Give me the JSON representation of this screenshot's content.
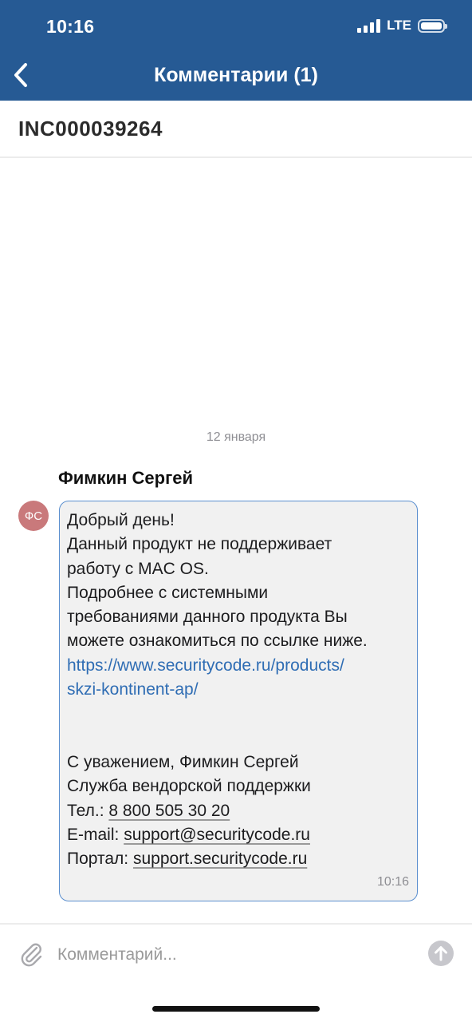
{
  "status_bar": {
    "time": "10:16",
    "network": "LTE"
  },
  "header": {
    "title": "Комментарии (1)"
  },
  "incident": {
    "number": "INC000039264"
  },
  "thread": {
    "date_separator": "12 января",
    "messages": [
      {
        "author": "Фимкин Сергей",
        "avatar_initials": "ФС",
        "avatar_color": "#c9797b",
        "time": "10:16",
        "lines": [
          "Добрый день!",
          "Данный продукт не поддерживает",
          "работу с MAC OS.",
          "Подробнее с системными",
          "требованиями данного продукта Вы",
          "можете ознакомиться по ссылке ниже."
        ],
        "link_lines": [
          "https://www.securitycode.ru/products/",
          "skzi-kontinent-ap/"
        ],
        "signature": {
          "greeting": "С уважением, Фимкин Сергей",
          "department": "Служба вендорской поддержки",
          "phone_label": "Тел.: ",
          "phone": "8 800 505 30 20",
          "email_label": "E-mail: ",
          "email": "support@securitycode.ru",
          "portal_label": "Портал: ",
          "portal": "support.securitycode.ru"
        }
      }
    ]
  },
  "composer": {
    "placeholder": "Комментарий..."
  },
  "colors": {
    "header_bg": "#265a94",
    "link": "#2f6db4",
    "bubble_bg": "#f1f1f1",
    "bubble_border": "#5b8fcf"
  }
}
